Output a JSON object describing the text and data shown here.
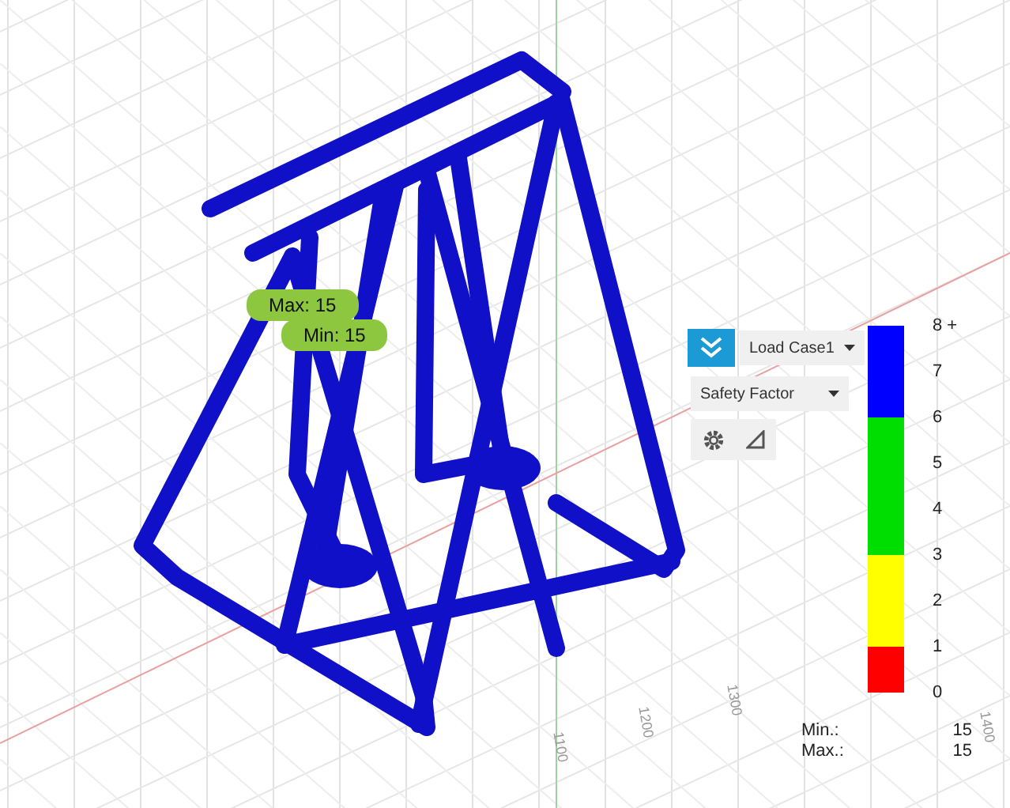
{
  "viewport": {
    "tags": [
      {
        "text": "Max: 15"
      },
      {
        "text": "Min: 15"
      }
    ],
    "grid_labels": [
      "1100",
      "1200",
      "1300",
      "1400"
    ]
  },
  "result_panel": {
    "load_case": "Load Case1",
    "result_type": "Safety Factor"
  },
  "legend": {
    "bands": [
      {
        "color": "#0000ff"
      },
      {
        "color": "#00dd00"
      },
      {
        "color": "#ffff00"
      },
      {
        "color": "#ff0000"
      }
    ],
    "ticks": [
      "8 +",
      "7",
      "6",
      "5",
      "4",
      "3",
      "2",
      "1",
      "0"
    ]
  },
  "summary": [
    {
      "label": "Min.:",
      "value": "15"
    },
    {
      "label": "Max.:",
      "value": "15"
    }
  ]
}
